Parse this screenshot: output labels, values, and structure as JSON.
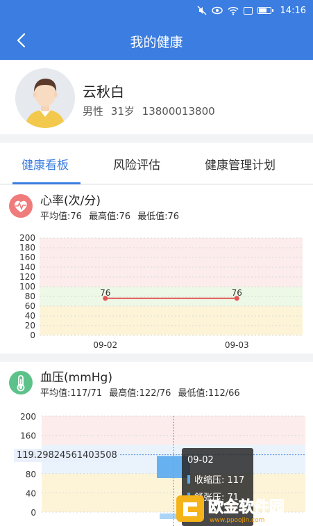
{
  "status_bar": {
    "time": "14:16"
  },
  "nav": {
    "title": "我的健康"
  },
  "profile": {
    "name": "云秋白",
    "gender": "男性",
    "age": "31岁",
    "phone": "13800013800"
  },
  "tabs": [
    {
      "label": "健康看板",
      "active": true
    },
    {
      "label": "风险评估",
      "active": false
    },
    {
      "label": "健康管理计划",
      "active": false
    }
  ],
  "heart_rate": {
    "title": "心率(次/分)",
    "avg": "平均值:76",
    "max": "最高值:76",
    "min": "最低值:76",
    "icon": "heart-pulse-icon",
    "icon_color": "#ef7b7b"
  },
  "blood_pressure": {
    "title": "血压(mmHg)",
    "avg": "平均值:117/71",
    "max": "最高值:122/76",
    "min": "最低值:112/66",
    "icon": "thermometer-icon",
    "icon_color": "#5cc28a",
    "crosshair_value": "119.29824561403508",
    "tooltip": {
      "date": "09-02",
      "systolic": "收缩压: 117",
      "diastolic": "舒张压: 71"
    }
  },
  "watermark": {
    "text": "欧金软件园",
    "url": "www.ppoojin.com"
  },
  "chart_data": [
    {
      "type": "line",
      "title": "心率(次/分)",
      "categories": [
        "09-02",
        "09-03"
      ],
      "series": [
        {
          "values": [
            76,
            76
          ]
        }
      ],
      "data_labels": [
        "76",
        "76"
      ],
      "y_ticks": [
        "200",
        "180",
        "160",
        "140",
        "120",
        "100",
        "80",
        "60",
        "40",
        "20",
        "0"
      ],
      "ylim": [
        0,
        200
      ],
      "bands": [
        {
          "from": 0,
          "to": 60,
          "color": "#fdf4d8"
        },
        {
          "from": 60,
          "to": 100,
          "color": "#eef8e6"
        },
        {
          "from": 100,
          "to": 200,
          "color": "#fcecec"
        }
      ],
      "line_color": "#e05555"
    },
    {
      "type": "bar",
      "title": "血压(mmHg)",
      "categories": [
        "09-02"
      ],
      "series": [
        {
          "name": "收缩压",
          "values": [
            117
          ]
        },
        {
          "name": "舒张压",
          "values": [
            71
          ]
        }
      ],
      "y_ticks": [
        "200",
        "160",
        "120",
        "80",
        "40",
        "0"
      ],
      "ylim": [
        0,
        200
      ],
      "bands": [
        {
          "from": 0,
          "to": 80,
          "color": "#fdf4d8"
        },
        {
          "from": 80,
          "to": 140,
          "color": "#eaf3fc"
        },
        {
          "from": 140,
          "to": 200,
          "color": "#fcecec"
        }
      ],
      "bar_color": "#5aaaf0"
    }
  ]
}
